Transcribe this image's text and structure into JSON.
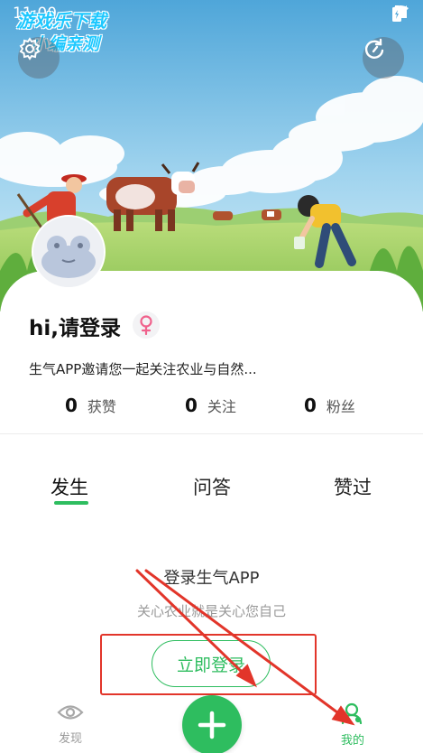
{
  "status_bar": {
    "time": "11:00"
  },
  "watermark": {
    "line1": "游戏乐下载",
    "line2": "小编亲测"
  },
  "header": {
    "settings_icon": "gear-icon",
    "refresh_icon": "refresh-icon"
  },
  "profile": {
    "username": "hi,请登录",
    "gender_icon": "female-icon",
    "bio": "生气APP邀请您一起关注农业与自然...",
    "stats": [
      {
        "count": "0",
        "label": "获赞"
      },
      {
        "count": "0",
        "label": "关注"
      },
      {
        "count": "0",
        "label": "粉丝"
      }
    ]
  },
  "tabs": [
    {
      "label": "发生",
      "active": true
    },
    {
      "label": "问答",
      "active": false
    },
    {
      "label": "赞过",
      "active": false
    }
  ],
  "empty_state": {
    "title": "登录生气APP",
    "subtitle": "关心农业就是关心您自己",
    "login_button": "立即登录"
  },
  "bottom_nav": {
    "discover": {
      "label": "发现",
      "icon": "eye-icon"
    },
    "publish_icon": "plus-icon",
    "mine": {
      "label": "我的",
      "icon": "user-icon",
      "active": true
    }
  },
  "colors": {
    "accent": "#2ebd5f",
    "annotation": "#e2352a",
    "muted_text": "#999999"
  }
}
